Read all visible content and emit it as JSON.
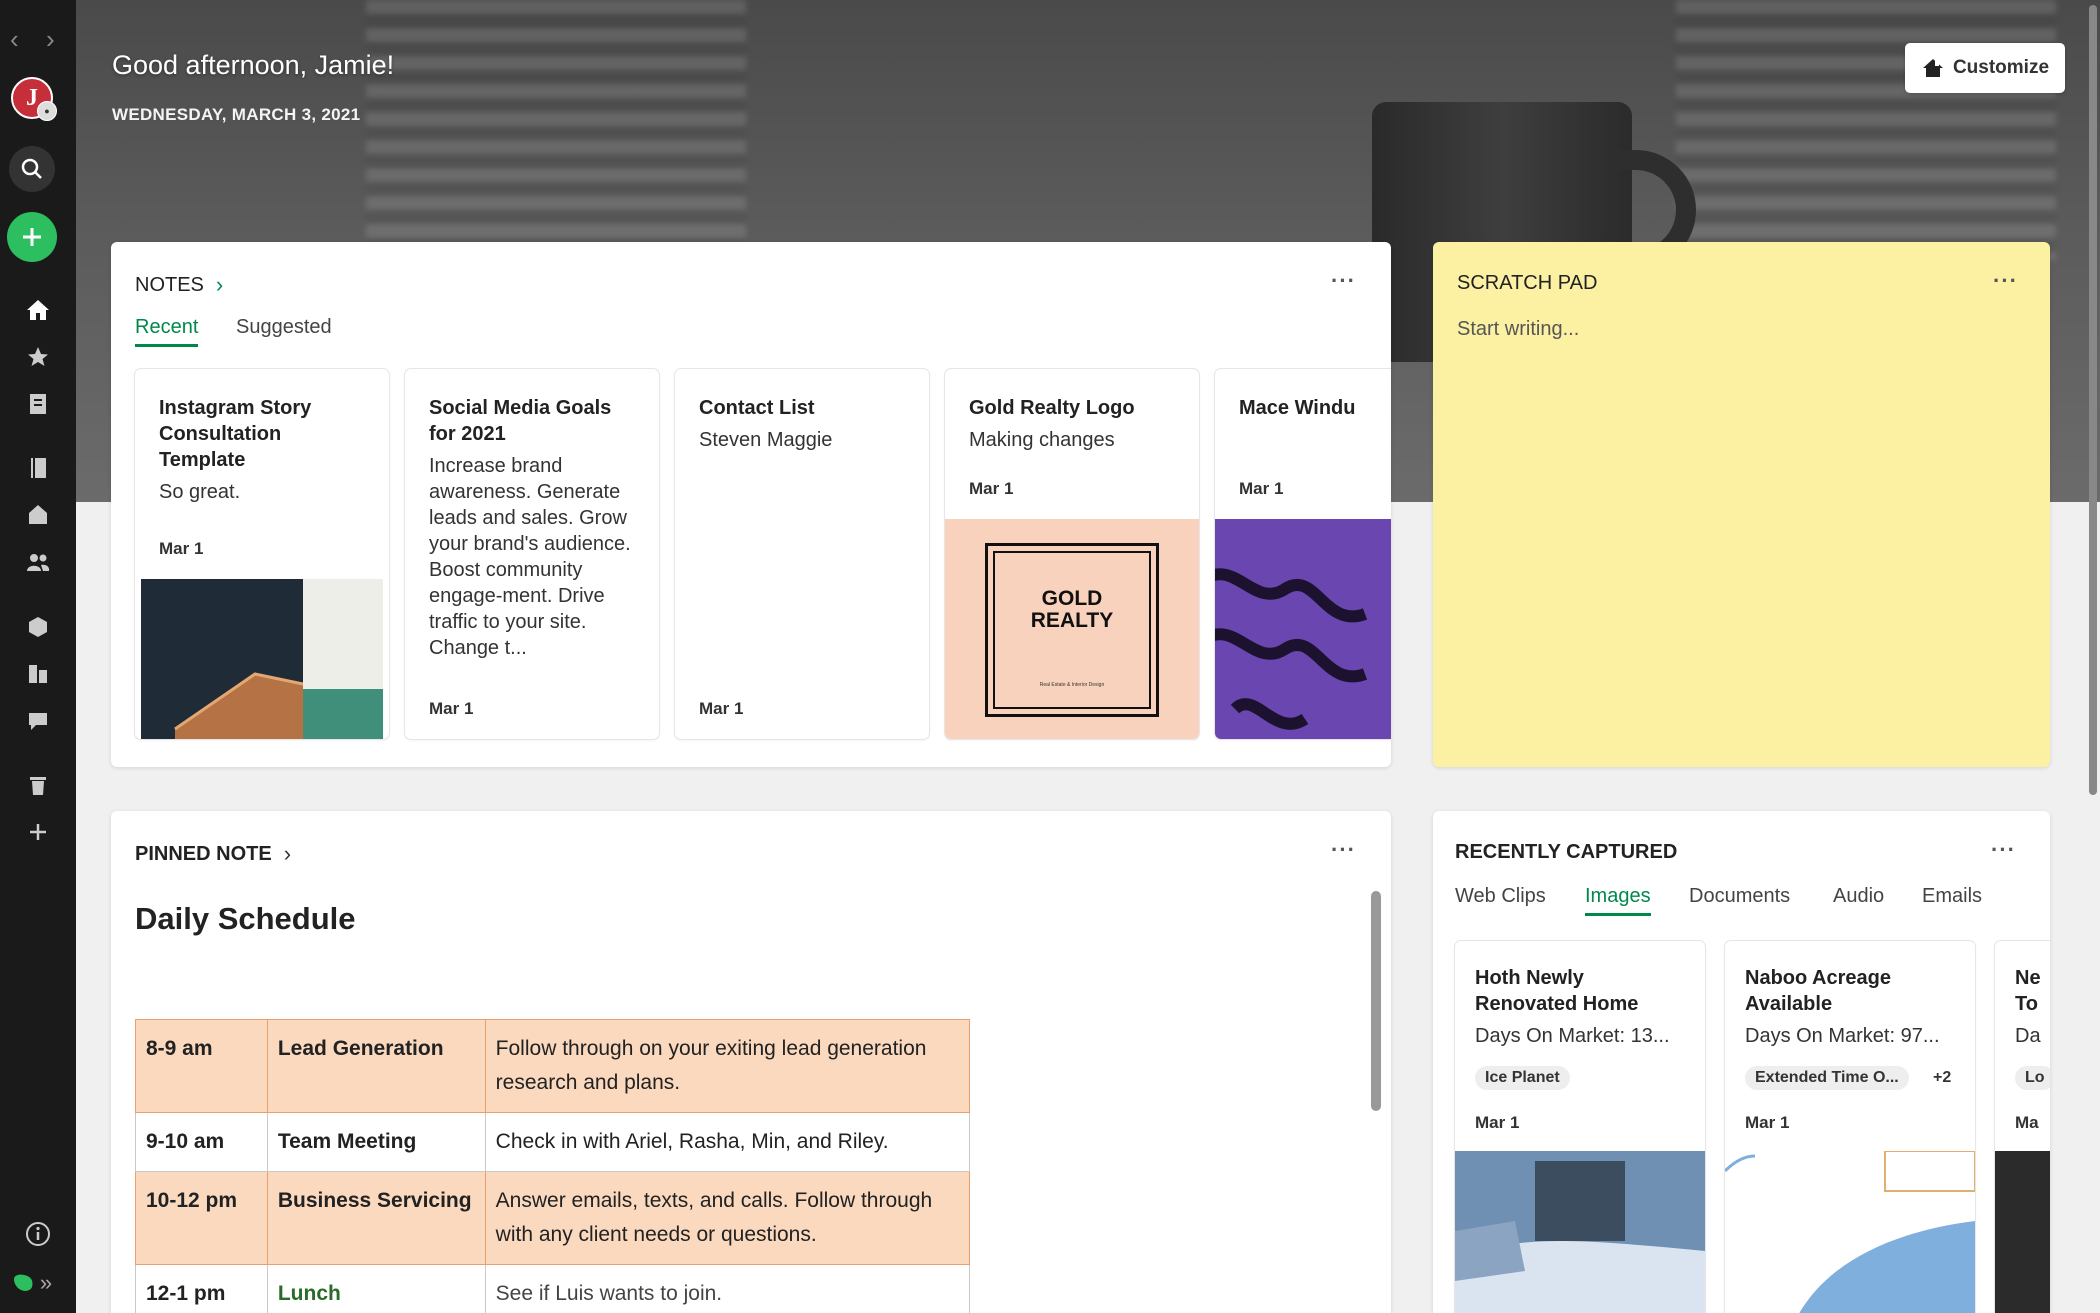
{
  "header": {
    "greeting": "Good afternoon, Jamie!",
    "date": "WEDNESDAY, MARCH 3, 2021",
    "customize_label": "Customize"
  },
  "sidebar": {
    "avatar_initial": "J",
    "icons": [
      "back-arrow-icon",
      "forward-arrow-icon",
      "search-icon",
      "new-note-icon",
      "home-icon",
      "star-icon",
      "notes-icon",
      "notebooks-icon",
      "spaces-icon",
      "shared-icon",
      "tags-icon",
      "templates-icon",
      "chat-icon",
      "trash-icon",
      "add-icon",
      "info-icon",
      "evernote-logo-icon",
      "expand-icon"
    ]
  },
  "notes": {
    "title": "NOTES",
    "tabs": [
      "Recent",
      "Suggested"
    ],
    "cards": [
      {
        "title": "Instagram Story Consultation Template",
        "body": "So great.",
        "date": "Mar 1"
      },
      {
        "title": "Social Media Goals for 2021",
        "body": "Increase brand awareness. Generate leads and sales. Grow your brand's audience. Boost community engage-ment. Drive traffic to your site. Change t...",
        "date": "Mar 1"
      },
      {
        "title": "Contact List",
        "body": "Steven Maggie",
        "date": "Mar 1"
      },
      {
        "title": "Gold Realty Logo",
        "body": "Making changes",
        "date": "Mar 1",
        "logo_line1": "GOLD",
        "logo_line2": "REALTY",
        "logo_sub": "Real Estate & Interior Design"
      },
      {
        "title": "Mace Windu",
        "body": "",
        "date": "Mar 1"
      }
    ]
  },
  "scratch_pad": {
    "title": "SCRATCH PAD",
    "placeholder": "Start writing..."
  },
  "pinned": {
    "title": "PINNED NOTE",
    "doc_title": "Daily Schedule",
    "rows": [
      {
        "time": "8-9 am",
        "task": "Lead Generation",
        "detail": "Follow through on your exiting lead generation research and plans."
      },
      {
        "time": "9-10 am",
        "task": "Team Meeting",
        "detail": "Check in with Ariel, Rasha, Min, and Riley."
      },
      {
        "time": "10-12 pm",
        "task": "Business Servicing",
        "detail": "Answer emails, texts, and calls. Follow through with any client needs or questions."
      },
      {
        "time": "12-1 pm",
        "task": "Lunch",
        "detail": "See if Luis wants to join."
      }
    ]
  },
  "captured": {
    "title": "RECENTLY CAPTURED",
    "tabs": [
      "Web Clips",
      "Images",
      "Documents",
      "Audio",
      "Emails"
    ],
    "cards": [
      {
        "title": "Hoth Newly Renovated Home",
        "body": "Days On Market: 13...",
        "tag": "Ice Planet",
        "extra": "",
        "date": "Mar 1"
      },
      {
        "title": "Naboo Acreage Available",
        "body": "Days On Market: 97...",
        "tag": "Extended Time O...",
        "extra": "+2",
        "date": "Mar 1"
      },
      {
        "title": "Ne To",
        "body": "Da",
        "tag": "Lo",
        "extra": "",
        "date": "Ma"
      }
    ]
  },
  "colors": {
    "accent": "#00884a",
    "new_button": "#2dbe60",
    "scratch_bg": "#fcf0a3",
    "highlight_row": "#fad9bf"
  }
}
